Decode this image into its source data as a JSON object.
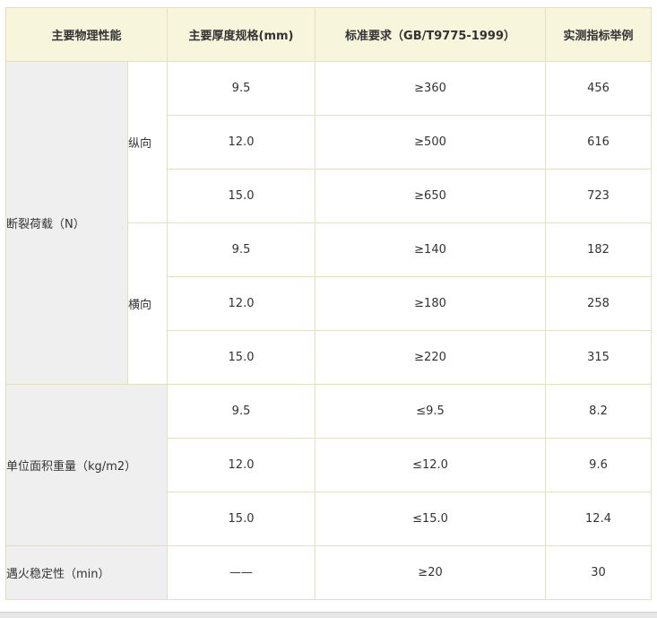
{
  "headers": {
    "property": "主要物理性能",
    "thickness": "主要厚度规格(mm)",
    "standard": "标准要求（GB/T9775-1999）",
    "measured": "实测指标举例"
  },
  "groups": {
    "breaking_load": {
      "label": "断裂荷载（N）",
      "longitudinal": {
        "label": "纵向",
        "rows": [
          {
            "thickness": "9.5",
            "standard": "≥360",
            "measured": "456"
          },
          {
            "thickness": "12.0",
            "standard": "≥500",
            "measured": "616"
          },
          {
            "thickness": "15.0",
            "standard": "≥650",
            "measured": "723"
          }
        ]
      },
      "transverse": {
        "label": "横向",
        "rows": [
          {
            "thickness": "9.5",
            "standard": "≥140",
            "measured": "182"
          },
          {
            "thickness": "12.0",
            "standard": "≥180",
            "measured": "258"
          },
          {
            "thickness": "15.0",
            "standard": "≥220",
            "measured": "315"
          }
        ]
      }
    },
    "area_weight": {
      "label": "单位面积重量（kg/m2）",
      "rows": [
        {
          "thickness": "9.5",
          "standard": "≤9.5",
          "measured": "8.2"
        },
        {
          "thickness": "12.0",
          "standard": "≤12.0",
          "measured": "9.6"
        },
        {
          "thickness": "15.0",
          "standard": "≤15.0",
          "measured": "12.4"
        }
      ]
    },
    "fire_stability": {
      "label": "遇火稳定性（min）",
      "thickness": "——",
      "standard": "≥20",
      "measured": "30"
    }
  }
}
